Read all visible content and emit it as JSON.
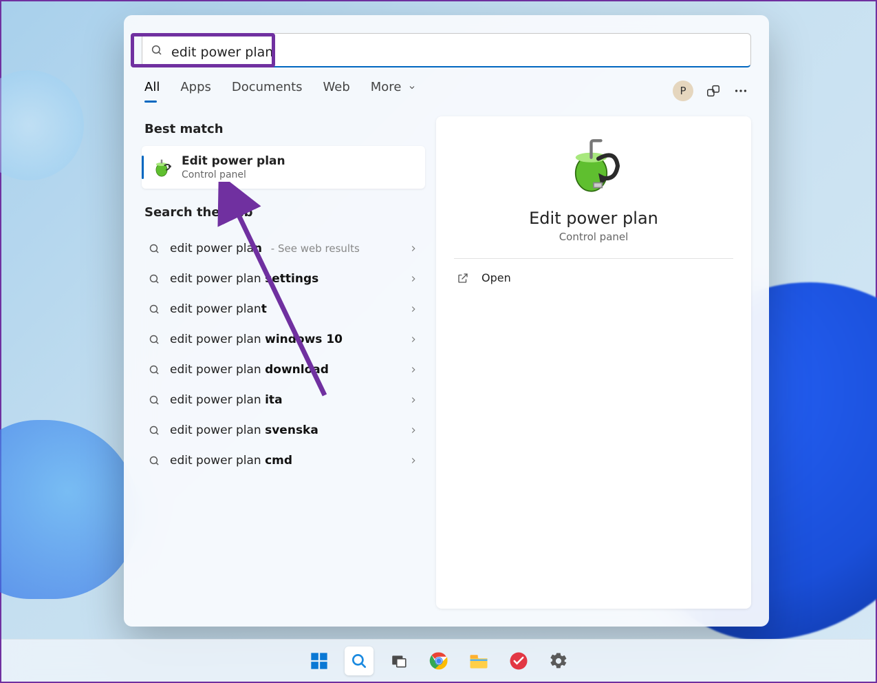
{
  "search": {
    "value": "edit power plan"
  },
  "tabs": {
    "all": "All",
    "apps": "Apps",
    "documents": "Documents",
    "web": "Web",
    "more": "More"
  },
  "user": {
    "initial": "P"
  },
  "sections": {
    "best_match": "Best match",
    "search_web": "Search the web"
  },
  "best_match": {
    "title": "Edit power plan",
    "subtitle": "Control panel"
  },
  "web_results": [
    {
      "prefix": "edit power pla",
      "bold": "n",
      "hint": " - See web results"
    },
    {
      "prefix": "edit power plan ",
      "bold": "settings"
    },
    {
      "prefix": "edit power plan",
      "bold": "t"
    },
    {
      "prefix": "edit power plan ",
      "bold": "windows 10"
    },
    {
      "prefix": "edit power plan ",
      "bold": "download"
    },
    {
      "prefix": "edit power plan ",
      "bold": "ita"
    },
    {
      "prefix": "edit power plan ",
      "bold": "svenska"
    },
    {
      "prefix": "edit power plan ",
      "bold": "cmd"
    }
  ],
  "preview": {
    "title": "Edit power plan",
    "subtitle": "Control panel",
    "open": "Open"
  }
}
